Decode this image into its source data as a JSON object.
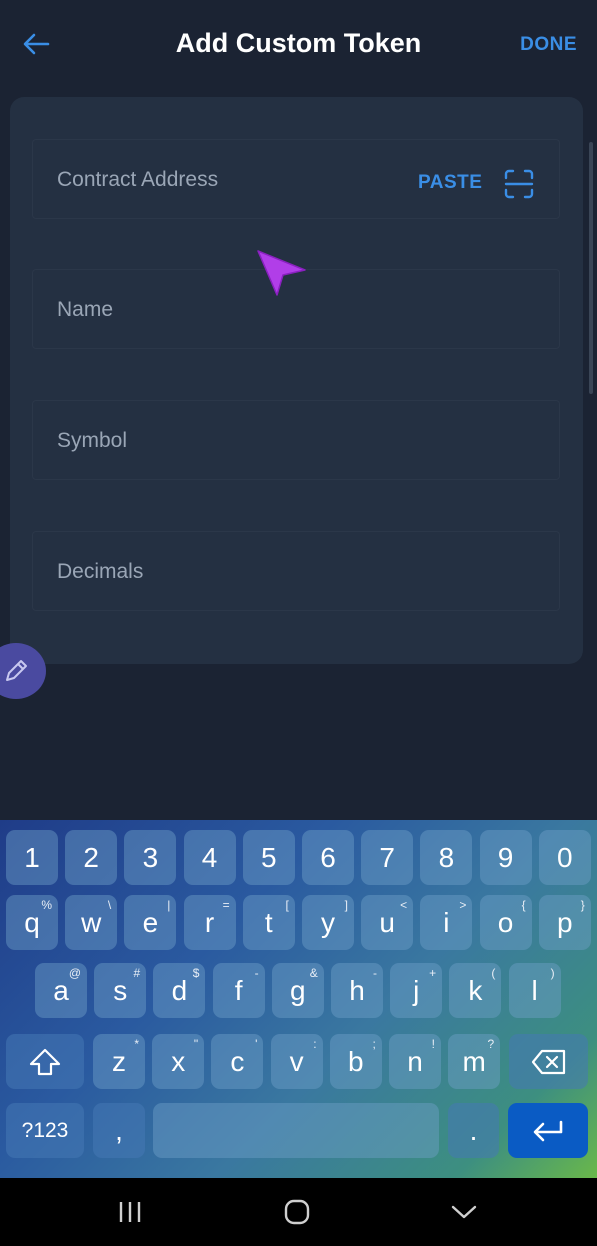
{
  "header": {
    "title": "Add Custom Token",
    "done_label": "DONE"
  },
  "form": {
    "contract_address": {
      "placeholder": "Contract Address",
      "paste_label": "PASTE"
    },
    "name": {
      "placeholder": "Name"
    },
    "symbol": {
      "placeholder": "Symbol"
    },
    "decimals": {
      "placeholder": "Decimals"
    }
  },
  "keyboard": {
    "row1": [
      "1",
      "2",
      "3",
      "4",
      "5",
      "6",
      "7",
      "8",
      "9",
      "0"
    ],
    "row2": [
      [
        "q",
        "%"
      ],
      [
        "w",
        "\\"
      ],
      [
        "e",
        "|"
      ],
      [
        "r",
        "="
      ],
      [
        "t",
        "["
      ],
      [
        "y",
        "]"
      ],
      [
        "u",
        "<"
      ],
      [
        "i",
        ">"
      ],
      [
        "o",
        "{"
      ],
      [
        "p",
        "}"
      ]
    ],
    "row3": [
      [
        "a",
        "@"
      ],
      [
        "s",
        "#"
      ],
      [
        "d",
        "$"
      ],
      [
        "f",
        "-"
      ],
      [
        "g",
        "&"
      ],
      [
        "h",
        "-"
      ],
      [
        "j",
        "+"
      ],
      [
        "k",
        "("
      ],
      [
        "l",
        ")"
      ]
    ],
    "row4": [
      [
        "z",
        "*"
      ],
      [
        "x",
        "\""
      ],
      [
        "c",
        "'"
      ],
      [
        "v",
        ":"
      ],
      [
        "b",
        ";"
      ],
      [
        "n",
        "!"
      ],
      [
        "m",
        "?"
      ]
    ],
    "symbols_label": "?123",
    "comma_label": ",",
    "period_label": "."
  },
  "colors": {
    "accent": "#3a8ee6",
    "background": "#1b2333",
    "card": "#243042"
  }
}
